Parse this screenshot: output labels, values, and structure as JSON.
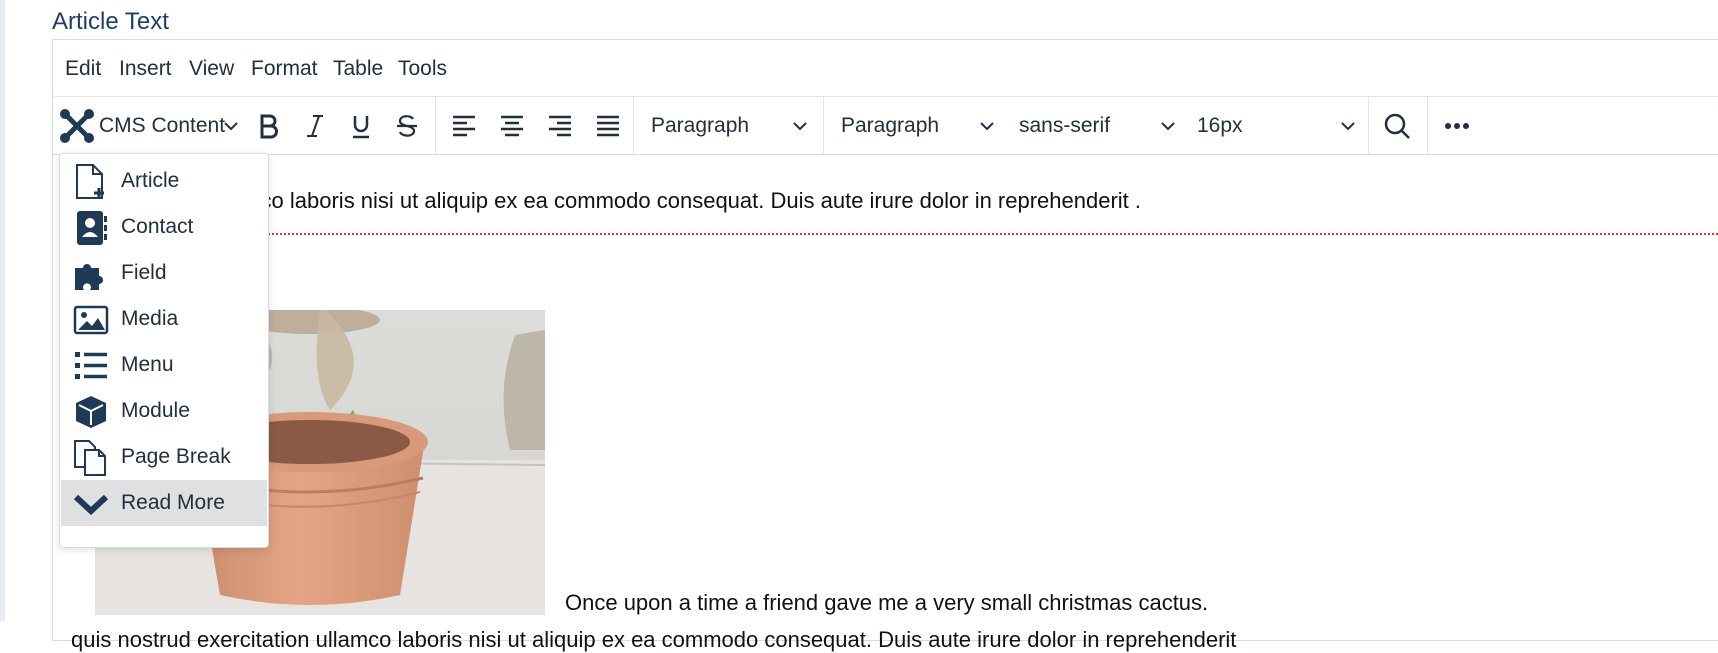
{
  "field_label": "Article Text",
  "menubar": {
    "items": [
      "Edit",
      "Insert",
      "View",
      "Format",
      "Table",
      "Tools"
    ]
  },
  "toolbar": {
    "cms_content_label": "CMS Content",
    "blocks_select": "Paragraph",
    "format_select": "Paragraph",
    "font_family": "sans-serif",
    "font_size": "16px"
  },
  "content": {
    "paragraph_1": "d exercitation ullamco laboris nisi ut aliquip ex ea commodo consequat. Duis aute irure dolor in reprehenderit .",
    "caption": "Once upon a time a friend gave me a very small christmas cactus.",
    "paragraph_2": "quis nostrud exercitation ullamco laboris nisi ut aliquip ex ea commodo consequat. Duis aute irure dolor in reprehenderit"
  },
  "cms_dropdown": {
    "items": [
      {
        "label": "Article",
        "icon": "file-plus-icon"
      },
      {
        "label": "Contact",
        "icon": "address-book-icon"
      },
      {
        "label": "Field",
        "icon": "puzzle-piece-icon"
      },
      {
        "label": "Media",
        "icon": "image-icon"
      },
      {
        "label": "Menu",
        "icon": "list-icon"
      },
      {
        "label": "Module",
        "icon": "cube-icon"
      },
      {
        "label": "Page Break",
        "icon": "copy-icon"
      },
      {
        "label": "Read More",
        "icon": "chevron-down-icon"
      }
    ],
    "highlighted": "Read More"
  },
  "colors": {
    "label_blue": "#1e3f66",
    "toolbar_text": "#222f3e",
    "pagebreak_red": "#e0383e",
    "highlight_bg": "#dee0e2"
  }
}
